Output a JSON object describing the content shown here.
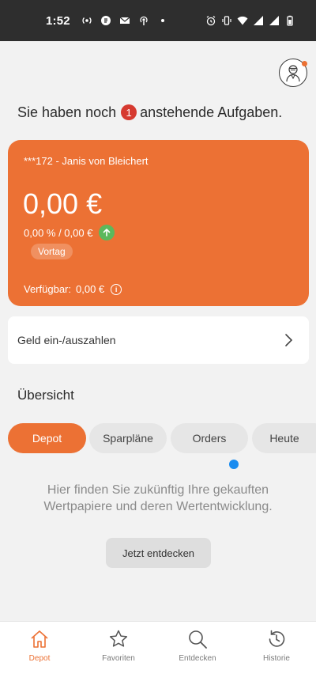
{
  "status_bar": {
    "time": "1:52",
    "left_icons": [
      "radio-icon",
      "signal-app-icon",
      "mail-icon",
      "podcast-icon",
      "dot-icon"
    ],
    "right_icons": [
      "alarm-icon",
      "vibrate-icon",
      "wifi-icon",
      "cell-signal-icon",
      "cell-signal-icon-2",
      "battery-icon"
    ]
  },
  "header": {
    "tasks_prefix": "Sie haben noch",
    "tasks_count": "1",
    "tasks_suffix": "anstehende Aufgaben."
  },
  "account": {
    "name": "***172 - Janis von Bleichert",
    "balance": "0,00 €",
    "performance": "0,00 % / 0,00 €",
    "period": "Vortag",
    "available_label": "Verfügbar:",
    "available_value": "0,00 €",
    "accent_color": "#ec7134"
  },
  "money_row": {
    "label": "Geld ein-/auszahlen"
  },
  "overview": {
    "title": "Übersicht",
    "tabs": [
      {
        "label": "Depot",
        "active": true
      },
      {
        "label": "Sparpläne",
        "active": false
      },
      {
        "label": "Orders",
        "active": false
      },
      {
        "label": "Heute",
        "active": false
      }
    ],
    "empty_text_line1": "Hier finden Sie zukünftig Ihre gekauften",
    "empty_text_line2": "Wertpapiere und deren Wertentwicklung.",
    "discover_button": "Jetzt entdecken"
  },
  "bottom_nav": {
    "items": [
      {
        "label": "Depot",
        "icon": "home-icon",
        "active": true
      },
      {
        "label": "Favoriten",
        "icon": "star-icon",
        "active": false
      },
      {
        "label": "Entdecken",
        "icon": "search-icon",
        "active": false
      },
      {
        "label": "Historie",
        "icon": "history-icon",
        "active": false
      }
    ]
  }
}
